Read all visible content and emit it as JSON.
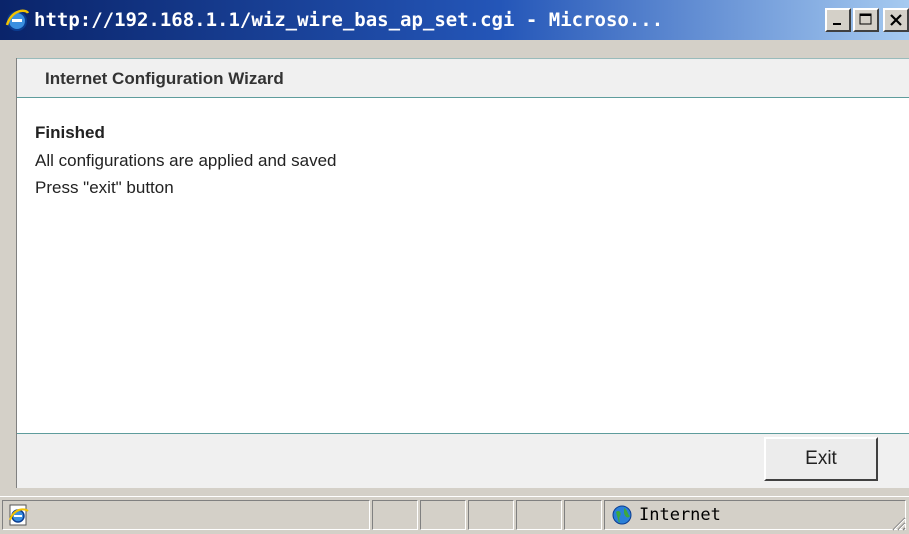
{
  "window": {
    "title": "http://192.168.1.1/wiz_wire_bas_ap_set.cgi - Microso...",
    "controls": {
      "minimize": "minimize",
      "maximize": "maximize",
      "close": "close"
    }
  },
  "wizard": {
    "header": "Internet Configuration Wizard",
    "message_title": "Finished",
    "message_line1": "All configurations are applied and saved",
    "message_line2": "Press \"exit\" button",
    "exit_label": "Exit"
  },
  "statusbar": {
    "zone_label": "Internet",
    "icons": {
      "page": "ie-page-icon",
      "zone": "globe-icon"
    }
  },
  "colors": {
    "titlebar_start": "#0a246a",
    "titlebar_end": "#a6caf0",
    "chrome": "#d4d0c8",
    "header_rule": "#5e9c9c"
  }
}
